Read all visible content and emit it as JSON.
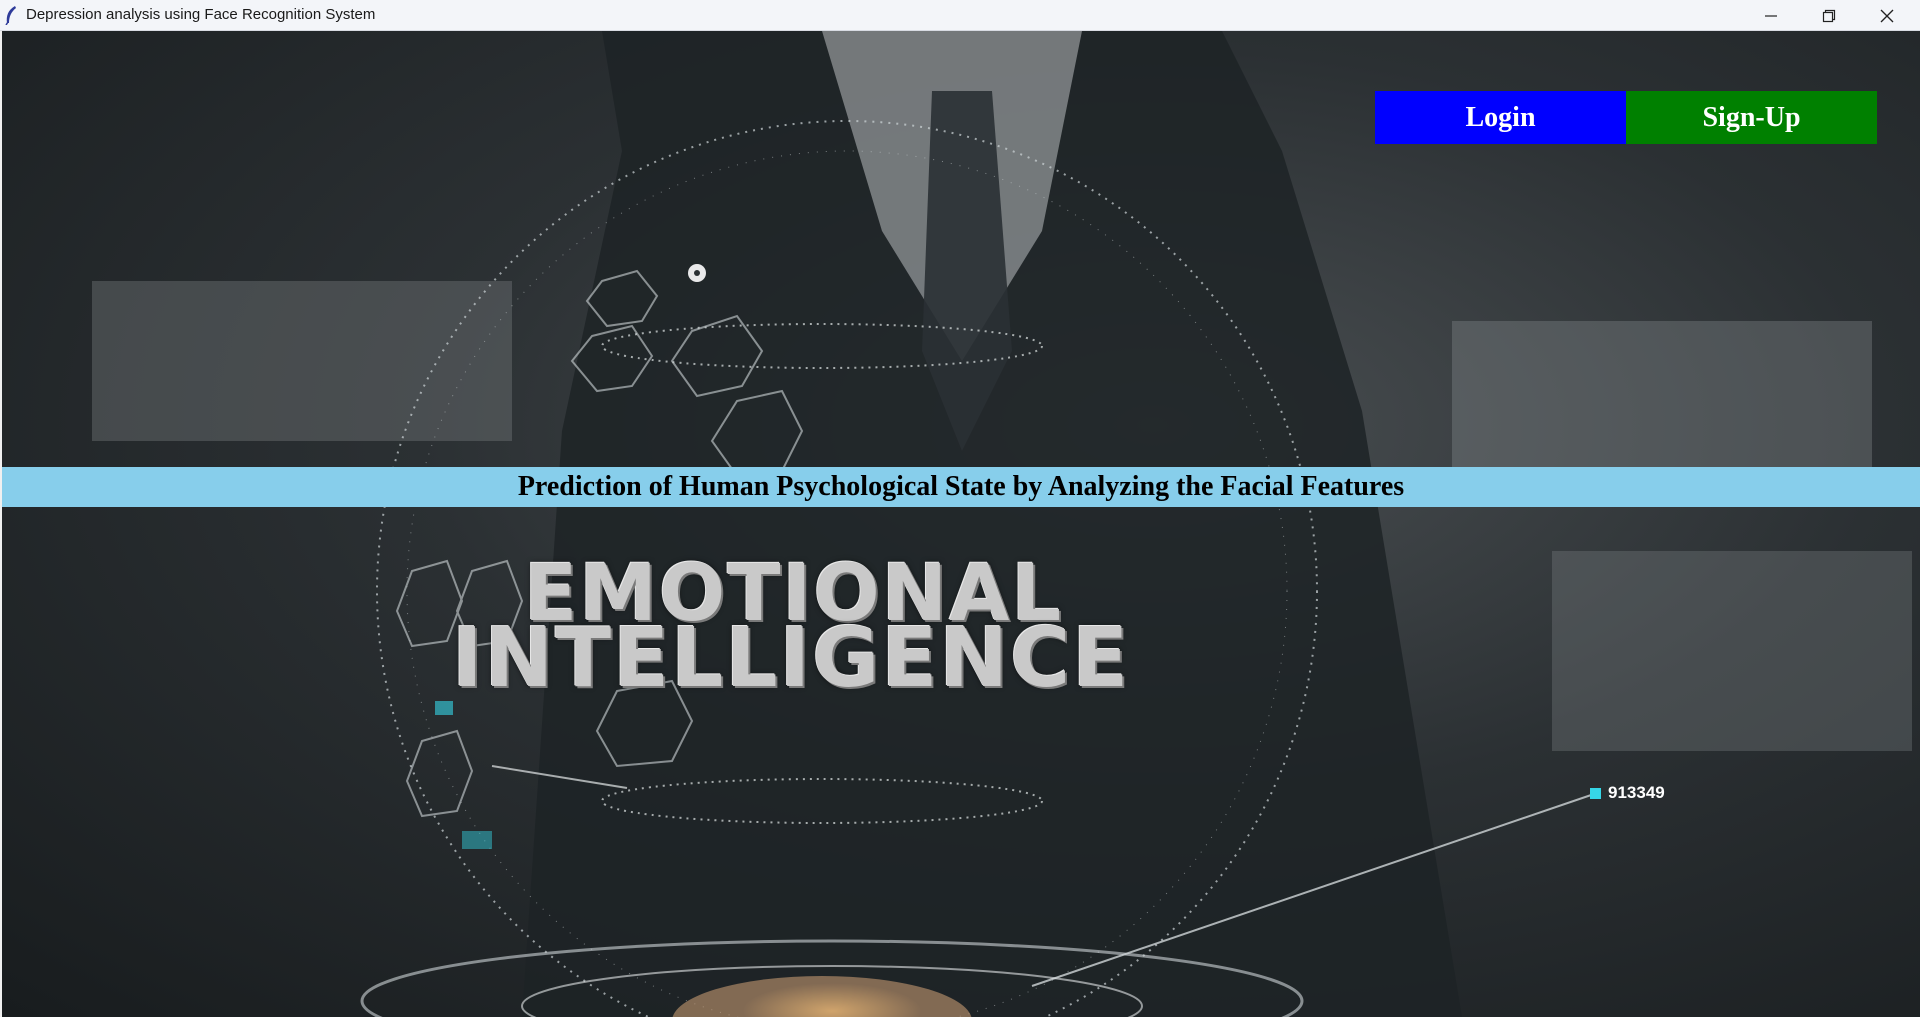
{
  "window": {
    "title": "Depression analysis using Face Recognition System",
    "controls": {
      "minimize": "minimize-icon",
      "maximize": "restore-icon",
      "close": "close-icon"
    }
  },
  "buttons": {
    "login": "Login",
    "signup": "Sign-Up"
  },
  "banner": {
    "text": "Prediction of Human Psychological State by Analyzing the Facial Features"
  },
  "background": {
    "word1": "EMOTIONAL",
    "word2": "INTELLIGENCE",
    "data_label": "913349"
  },
  "colors": {
    "login_bg": "#0000ff",
    "signup_bg": "#008000",
    "banner_bg": "#87ceeb"
  }
}
